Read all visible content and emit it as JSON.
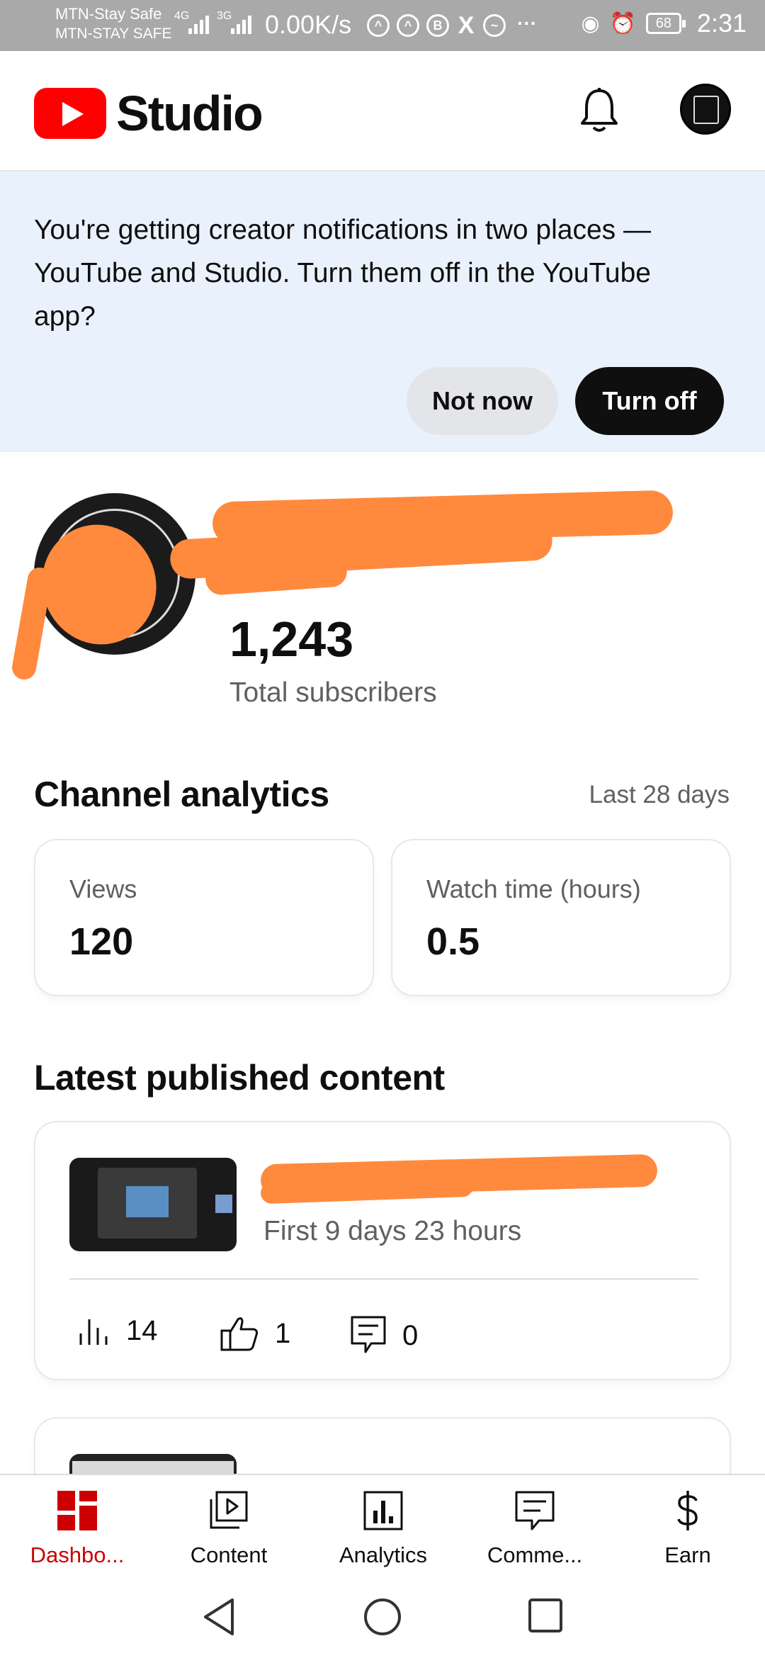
{
  "status_bar": {
    "carrier_1": "MTN-Stay Safe",
    "carrier_2": "MTN-STAY SAFE",
    "network_1": "4G",
    "network_2": "3G",
    "net_speed": "0.00K/s",
    "battery": "68",
    "time": "2:31"
  },
  "header": {
    "app_name": "Studio"
  },
  "banner": {
    "message": "You're getting creator notifications in two places — YouTube and Studio. Turn them off in the YouTube app?",
    "not_now_label": "Not now",
    "turn_off_label": "Turn off"
  },
  "channel": {
    "subscriber_count": "1,243",
    "subscriber_label": "Total subscribers"
  },
  "analytics": {
    "title": "Channel analytics",
    "range": "Last 28 days",
    "cards": [
      {
        "label": "Views",
        "value": "120"
      },
      {
        "label": "Watch time (hours)",
        "value": "0.5"
      }
    ]
  },
  "latest": {
    "title": "Latest published content",
    "video": {
      "meta": "First 9 days 23 hours",
      "views": "14",
      "likes": "1",
      "comments": "0"
    }
  },
  "bottom_nav": {
    "items": [
      {
        "label": "Dashbo...",
        "icon": "dashboard-icon",
        "active": true
      },
      {
        "label": "Content",
        "icon": "content-icon",
        "active": false
      },
      {
        "label": "Analytics",
        "icon": "analytics-icon",
        "active": false
      },
      {
        "label": "Comme...",
        "icon": "comments-icon",
        "active": false
      },
      {
        "label": "Earn",
        "icon": "earn-icon",
        "active": false
      }
    ]
  },
  "colors": {
    "brand_red": "#ff0000",
    "active_nav": "#cc0000",
    "banner_bg": "#e9f2fc",
    "redaction": "#ff8a3d"
  }
}
